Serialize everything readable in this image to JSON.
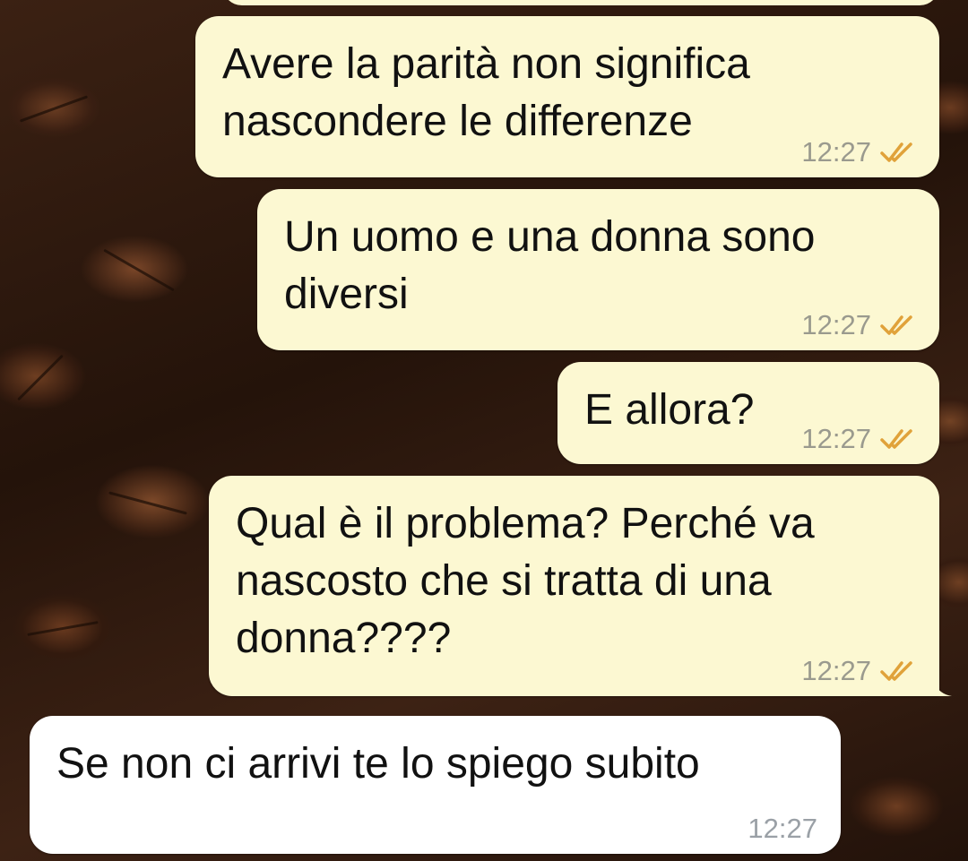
{
  "messages": [
    {
      "text": "Avere la parità non significa\nnascondere le differenze",
      "time": "12:27",
      "direction": "out",
      "status": "read"
    },
    {
      "text": "Un uomo e una donna sono\ndiversi",
      "time": "12:27",
      "direction": "out",
      "status": "read"
    },
    {
      "text": "E allora?",
      "time": "12:27",
      "direction": "out",
      "status": "read"
    },
    {
      "text": "Qual è il problema? Perché va\nnascosto che si tratta di una\ndonna????",
      "time": "12:27",
      "direction": "out",
      "status": "read"
    },
    {
      "text": "Se non ci arrivi te lo spiego subito",
      "time": "12:27",
      "direction": "in"
    }
  ],
  "icons": {
    "read_receipt": "double-check-icon"
  },
  "colors": {
    "outgoing_bubble": "#fcf8d2",
    "incoming_bubble": "#ffffff",
    "tick": "#e0a23a"
  }
}
